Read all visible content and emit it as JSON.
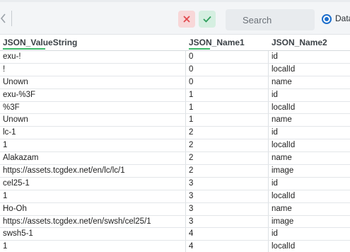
{
  "toolbar": {
    "search_placeholder": "Search",
    "radio_label": "Data"
  },
  "grid": {
    "columns": [
      "JSON_ValueString",
      "JSON_Name1",
      "JSON_Name2"
    ],
    "rows": [
      [
        "exu-!",
        "0",
        "id"
      ],
      [
        "!",
        "0",
        "localId"
      ],
      [
        "Unown",
        "0",
        "name"
      ],
      [
        "exu-%3F",
        "1",
        "id"
      ],
      [
        "%3F",
        "1",
        "localId"
      ],
      [
        "Unown",
        "1",
        "name"
      ],
      [
        "lc-1",
        "2",
        "id"
      ],
      [
        "1",
        "2",
        "localId"
      ],
      [
        "Alakazam",
        "2",
        "name"
      ],
      [
        "https://assets.tcgdex.net/en/lc/lc/1",
        "2",
        "image"
      ],
      [
        "cel25-1",
        "3",
        "id"
      ],
      [
        "1",
        "3",
        "localId"
      ],
      [
        "Ho-Oh",
        "3",
        "name"
      ],
      [
        "https://assets.tcgdex.net/en/swsh/cel25/1",
        "3",
        "image"
      ],
      [
        "swsh5-1",
        "4",
        "id"
      ],
      [
        "1",
        "4",
        "localId"
      ]
    ]
  },
  "colors": {
    "accent": "#1e6fcc",
    "header_underline": "#3cba6a",
    "cancel": "#e0474c",
    "confirm": "#2e9e5b"
  },
  "icons": [
    "chevron-left-icon",
    "close-icon",
    "check-icon",
    "search-icon",
    "radio-selected-icon"
  ]
}
